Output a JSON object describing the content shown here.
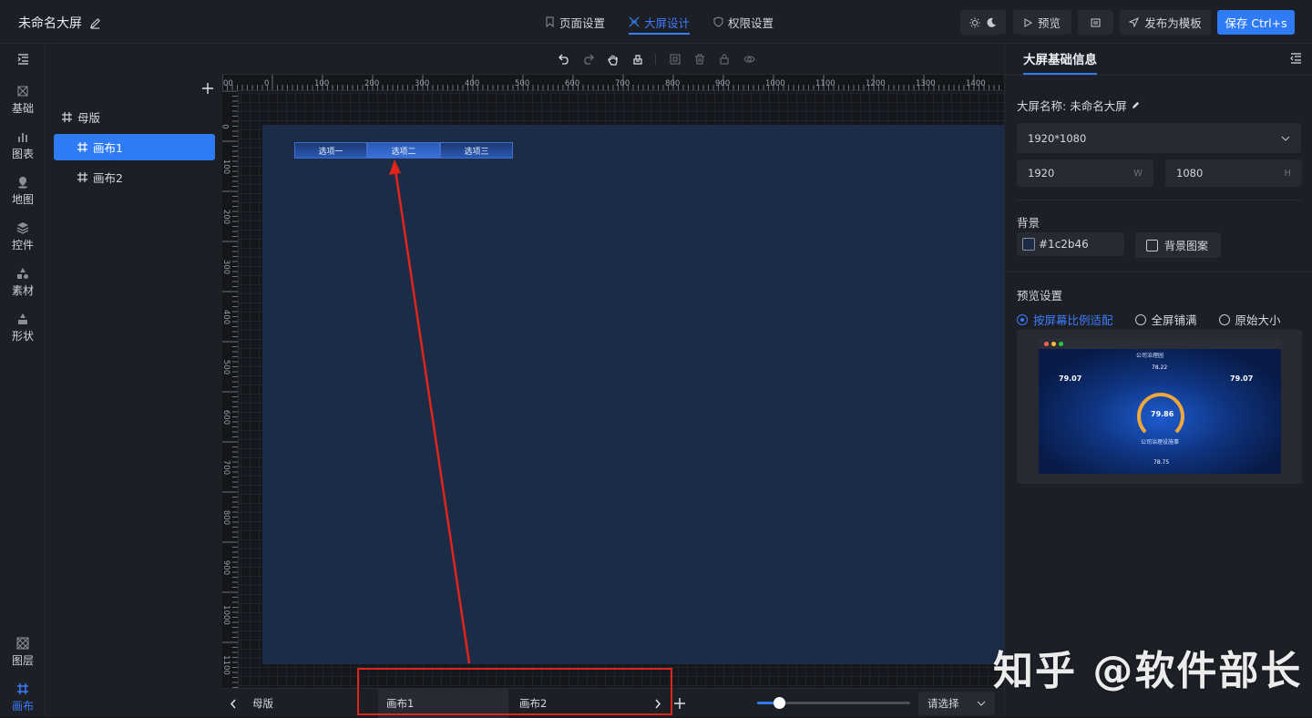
{
  "header": {
    "title": "未命名大屏",
    "tabs": [
      {
        "label": "页面设置",
        "icon": "bookmark-icon"
      },
      {
        "label": "大屏设计",
        "icon": "design-icon"
      },
      {
        "label": "权限设置",
        "icon": "shield-icon"
      }
    ],
    "preview_label": "预览",
    "publish_label": "发布为模板",
    "save_label": "保存 Ctrl+s"
  },
  "leftnav": {
    "items": [
      {
        "label": "基础"
      },
      {
        "label": "图表"
      },
      {
        "label": "地图"
      },
      {
        "label": "控件"
      },
      {
        "label": "素材"
      },
      {
        "label": "形状"
      }
    ],
    "bottom_items": [
      {
        "label": "图层"
      },
      {
        "label": "画布"
      }
    ]
  },
  "layers": {
    "items": [
      {
        "label": "母版"
      },
      {
        "label": "画布1"
      },
      {
        "label": "画布2"
      }
    ]
  },
  "ruler": {
    "h_ticks": [
      "00",
      "0",
      "100",
      "200",
      "300",
      "400",
      "500",
      "600",
      "700",
      "800",
      "900",
      "1000",
      "1100",
      "1200",
      "1300",
      "1400"
    ],
    "v_ticks": [
      "0",
      "100",
      "200",
      "300",
      "400",
      "500",
      "600",
      "700",
      "800",
      "900",
      "1000",
      "1100"
    ]
  },
  "canvas": {
    "background": "#1c2b46",
    "segmented": [
      "选项一",
      "选项二",
      "选项三"
    ]
  },
  "bottombar": {
    "master_label": "母版",
    "tabs": [
      "画布1",
      "画布2"
    ],
    "select_placeholder": "请选择"
  },
  "rightpanel": {
    "title": "大屏基础信息",
    "name_label": "大屏名称:",
    "name_value": "未命名大屏",
    "size_preset": "1920*1080",
    "width": "1920",
    "width_unit": "W",
    "height": "1080",
    "height_unit": "H",
    "bg_label": "背景",
    "bg_color": "#1c2b46",
    "bg_pattern_label": "背景图案",
    "preview_label": "预览设置",
    "preview_options": [
      "按屏幕比例适配",
      "全屏铺满",
      "原始大小"
    ],
    "thumb_title": "公司治理园",
    "thumb_values": [
      "79.07",
      "78.22",
      "79.07",
      "79.86",
      "78.75"
    ],
    "thumb_subtitle": "公司治理设施事"
  },
  "watermark": "知乎 @软件部长",
  "colors": {
    "accent": "#2f7bf5",
    "annotation": "#e0251b"
  }
}
